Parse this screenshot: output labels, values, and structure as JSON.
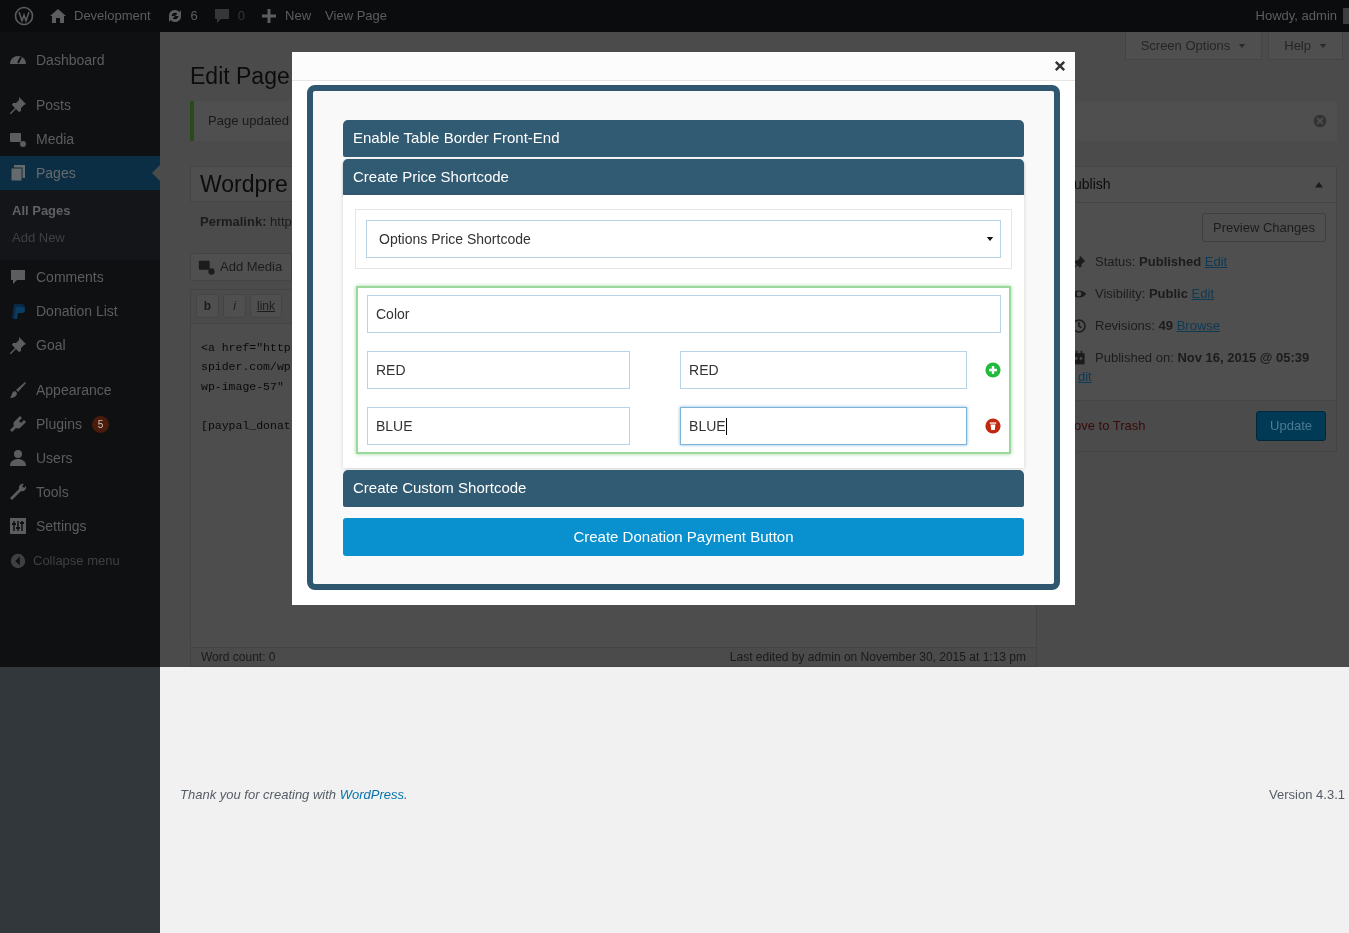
{
  "admin_bar": {
    "items": [
      {
        "kind": "logo"
      },
      {
        "kind": "home",
        "label": "Development"
      },
      {
        "kind": "updates",
        "label": "6"
      },
      {
        "kind": "comments",
        "label": "0"
      },
      {
        "kind": "new",
        "label": "New"
      },
      {
        "kind": "link",
        "label": "View Page"
      }
    ],
    "account": "Howdy, admin"
  },
  "sidebar": {
    "groups": [
      [
        {
          "label": "Dashboard",
          "kind": "gauge",
          "selected": false
        }
      ],
      [
        {
          "label": "Posts",
          "kind": "pin",
          "selected": false
        },
        {
          "label": "Media",
          "kind": "camera",
          "selected": false
        },
        {
          "label": "Pages",
          "kind": "pages",
          "selected": true,
          "children": [
            {
              "label": "All Pages",
              "selected": true
            },
            {
              "label": "Add New",
              "selected": false
            }
          ]
        },
        {
          "label": "Comments",
          "kind": "bubble",
          "selected": false
        },
        {
          "label": "Donation List",
          "kind": "donation",
          "selected": false
        },
        {
          "label": "Goal",
          "kind": "pin",
          "selected": false
        }
      ],
      [
        {
          "label": "Appearance",
          "kind": "brush",
          "selected": false
        },
        {
          "label": "Plugins",
          "kind": "plug",
          "selected": false,
          "badge": "5"
        },
        {
          "label": "Users",
          "kind": "user",
          "selected": false
        },
        {
          "label": "Tools",
          "kind": "wrench",
          "selected": false
        },
        {
          "label": "Settings",
          "kind": "sliders",
          "selected": false
        }
      ]
    ],
    "collapse": "Collapse menu"
  },
  "screen_tabs": [
    "Screen Options",
    "Help"
  ],
  "editor": {
    "heading": "Edit Page",
    "notice": "Page updated",
    "post_title": "Wordpre",
    "permalink_label": "Permalink:",
    "permalink_value": "http",
    "add_media": "Add Media",
    "quicktags": [
      "b",
      "i",
      "link"
    ],
    "code_blocks": [
      [
        "<a href=\"http",
        "spider.com/wp",
        "wp-image-57\""
      ],
      [
        "[paypal_donat"
      ]
    ],
    "word_count": "Word count: 0",
    "last_edited": "Last edited by admin on November 30, 2015 at 1:13 pm"
  },
  "publish": {
    "title": "ublish",
    "preview": "Preview Changes",
    "rows": [
      {
        "kind": "pin",
        "label": "Status:",
        "value": "Published",
        "link": "Edit"
      },
      {
        "kind": "eye",
        "label": "Visibility:",
        "value": "Public",
        "link": "Edit"
      },
      {
        "kind": "clock",
        "label": "Revisions:",
        "value": "49",
        "link": "Browse"
      },
      {
        "kind": "calendar",
        "label": "Published on:",
        "value": "Nov 16, 2015 @ 05:39",
        "link": "dit"
      }
    ],
    "trash": "ove to Trash",
    "update": "Update"
  },
  "footer": {
    "thanks": "Thank you for creating with ",
    "link": "WordPress",
    "after": ".",
    "version": "Version 4.3.1"
  },
  "modal": {
    "sections": [
      {
        "label": "Enable Table Border Front-End",
        "expanded": false
      },
      {
        "label": "Create Price Shortcode",
        "expanded": true
      },
      {
        "label": "Create Custom Shortcode",
        "expanded": false
      }
    ],
    "select": "Options Price Shortcode",
    "option_name": "Color",
    "rows": [
      {
        "name": "RED",
        "value": "RED",
        "focused": false,
        "kind": "add"
      },
      {
        "name": "BLUE",
        "value": "BLUE",
        "focused": true,
        "kind": "remove"
      }
    ],
    "submit": "Create Donation Payment Button"
  }
}
